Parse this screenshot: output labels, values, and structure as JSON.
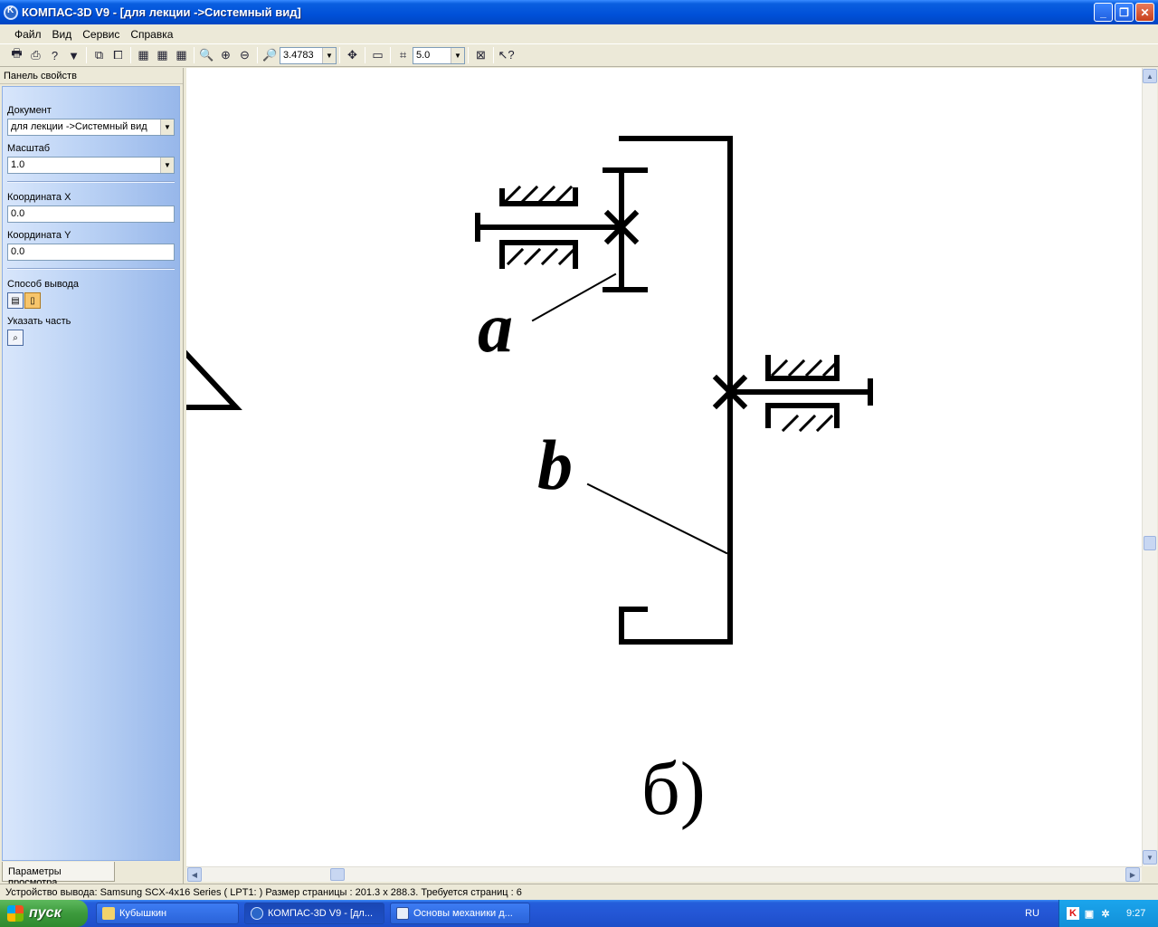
{
  "window": {
    "title": "КОМПАС-3D V9 - [для лекции ->Системный вид]"
  },
  "menu": [
    "Файл",
    "Вид",
    "Сервис",
    "Справка"
  ],
  "toolbar": {
    "zoom_value": "3.4783",
    "step_value": "5.0"
  },
  "panel": {
    "header": "Панель свойств",
    "document_label": "Документ",
    "document_value": "для лекции ->Системный вид",
    "scale_label": "Масштаб",
    "scale_value": "1.0",
    "coord_x_label": "Координата X",
    "coord_x_value": "0.0",
    "coord_y_label": "Координата Y",
    "coord_y_value": "0.0",
    "output_label": "Способ вывода",
    "part_label": "Указать часть",
    "tab_label": "Параметры просмотра"
  },
  "drawing": {
    "label_a": "a",
    "label_b": "b",
    "label_caption": "б)"
  },
  "status": {
    "text": "Устройство вывода: Samsung SCX-4x16 Series ( LPT1: )  Размер страницы : 201.3 x 288.3.  Требуется страниц : 6"
  },
  "taskbar": {
    "start_label": "пуск",
    "tasks": [
      "Кубышкин",
      "КОМПАС-3D V9 - [дл...",
      "Основы механики д..."
    ],
    "language": "RU",
    "clock": "9:27"
  },
  "colors": {
    "titlebar": "#0050D8",
    "panel_gradient_end": "#97b7ea",
    "taskbar": "#245edb",
    "start": "#3c9a3c"
  }
}
